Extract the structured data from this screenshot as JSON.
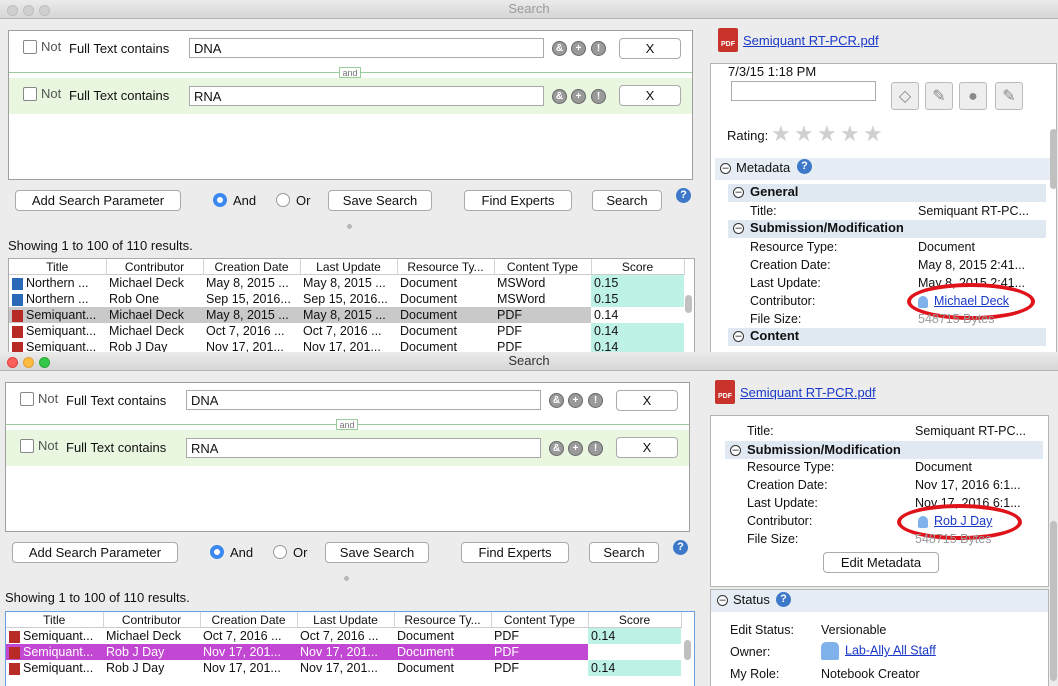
{
  "window_title": "Search",
  "query": {
    "rows": [
      {
        "not_label": "Not",
        "field_label": "Full Text contains",
        "value": "DNA",
        "remove_label": "X"
      },
      {
        "not_label": "Not",
        "field_label": "Full Text contains",
        "value": "RNA",
        "remove_label": "X"
      }
    ],
    "and_tag": "and",
    "op_and": "&",
    "op_plus": "+",
    "op_not": "!"
  },
  "controls": {
    "add_param": "Add Search Parameter",
    "and_label": "And",
    "or_label": "Or",
    "save_search": "Save Search",
    "find_experts": "Find Experts",
    "search": "Search",
    "help": "?"
  },
  "results_summary": "Showing 1 to 100 of 110 results.",
  "columns": [
    "Title",
    "Contributor",
    "Creation Date",
    "Last Update",
    "Resource Ty...",
    "Content Type",
    "Score"
  ],
  "results_top": [
    {
      "icon": "doc",
      "title": "Northern ...",
      "contributor": "Michael Deck",
      "created": "May 8, 2015 ...",
      "updated": "May 8, 2015 ...",
      "rtype": "Document",
      "ctype": "MSWord",
      "score": "0.15"
    },
    {
      "icon": "doc",
      "title": "Northern ...",
      "contributor": "Rob One",
      "created": "Sep 15, 2016...",
      "updated": "Sep 15, 2016...",
      "rtype": "Document",
      "ctype": "MSWord",
      "score": "0.15"
    },
    {
      "icon": "pdf",
      "title": "Semiquant...",
      "contributor": "Michael Deck",
      "created": "May 8, 2015 ...",
      "updated": "May 8, 2015 ...",
      "rtype": "Document",
      "ctype": "PDF",
      "score": "0.14",
      "selected": true
    },
    {
      "icon": "pdf",
      "title": "Semiquant...",
      "contributor": "Michael Deck",
      "created": "Oct 7, 2016 ...",
      "updated": "Oct 7, 2016 ...",
      "rtype": "Document",
      "ctype": "PDF",
      "score": "0.14"
    },
    {
      "icon": "pdf",
      "title": "Semiquant...",
      "contributor": "Rob J Day",
      "created": "Nov 17, 201...",
      "updated": "Nov 17, 201...",
      "rtype": "Document",
      "ctype": "PDF",
      "score": "0.14"
    }
  ],
  "results_bottom": [
    {
      "icon": "pdf",
      "title": "Semiquant...",
      "contributor": "Michael Deck",
      "created": "Oct 7, 2016 ...",
      "updated": "Oct 7, 2016 ...",
      "rtype": "Document",
      "ctype": "PDF",
      "score": "0.14"
    },
    {
      "icon": "pdf",
      "title": "Semiquant...",
      "contributor": "Rob J Day",
      "created": "Nov 17, 201...",
      "updated": "Nov 17, 201...",
      "rtype": "Document",
      "ctype": "PDF",
      "score": "0.14",
      "selected": true
    },
    {
      "icon": "pdf",
      "title": "Semiquant...",
      "contributor": "Rob J Day",
      "created": "Nov 17, 201...",
      "updated": "Nov 17, 201...",
      "rtype": "Document",
      "ctype": "PDF",
      "score": "0.14"
    }
  ],
  "detail": {
    "file_name": "Semiquant RT-PCR.pdf",
    "pdf_badge": "PDF",
    "timestamp": "7/3/15 1:18 PM",
    "rating_label": "Rating:",
    "metadata_label": "Metadata",
    "general_label": "General",
    "submission_label": "Submission/Modification",
    "content_label": "Content",
    "title_key": "Title:",
    "title_value": "Semiquant RT-PC...",
    "resource_type_key": "Resource Type:",
    "resource_type_value": "Document",
    "creation_key": "Creation Date:",
    "last_update_key": "Last Update:",
    "contributor_key": "Contributor:",
    "file_size_key": "File Size:",
    "file_size_value": "548715 Bytes",
    "top": {
      "creation_value": "May 8, 2015 2:41...",
      "last_update_value": "May 8, 2015 2:41...",
      "contributor": "Michael Deck"
    },
    "bottom": {
      "creation_value": "Nov 17, 2016 6:1...",
      "last_update_value": "Nov 17, 2016 6:1...",
      "contributor": "Rob J Day"
    },
    "edit_metadata": "Edit Metadata",
    "status_label": "Status",
    "edit_status_key": "Edit Status:",
    "edit_status_value": "Versionable",
    "owner_key": "Owner:",
    "owner_value": "Lab-Ally All Staff",
    "role_key": "My Role:",
    "role_value": "Notebook Creator"
  },
  "colors": {
    "highlight_oval": "#e0121a",
    "selected_row_purple": "#c247d2",
    "score_tint": "#bff2e6",
    "link": "#1b39c8"
  }
}
